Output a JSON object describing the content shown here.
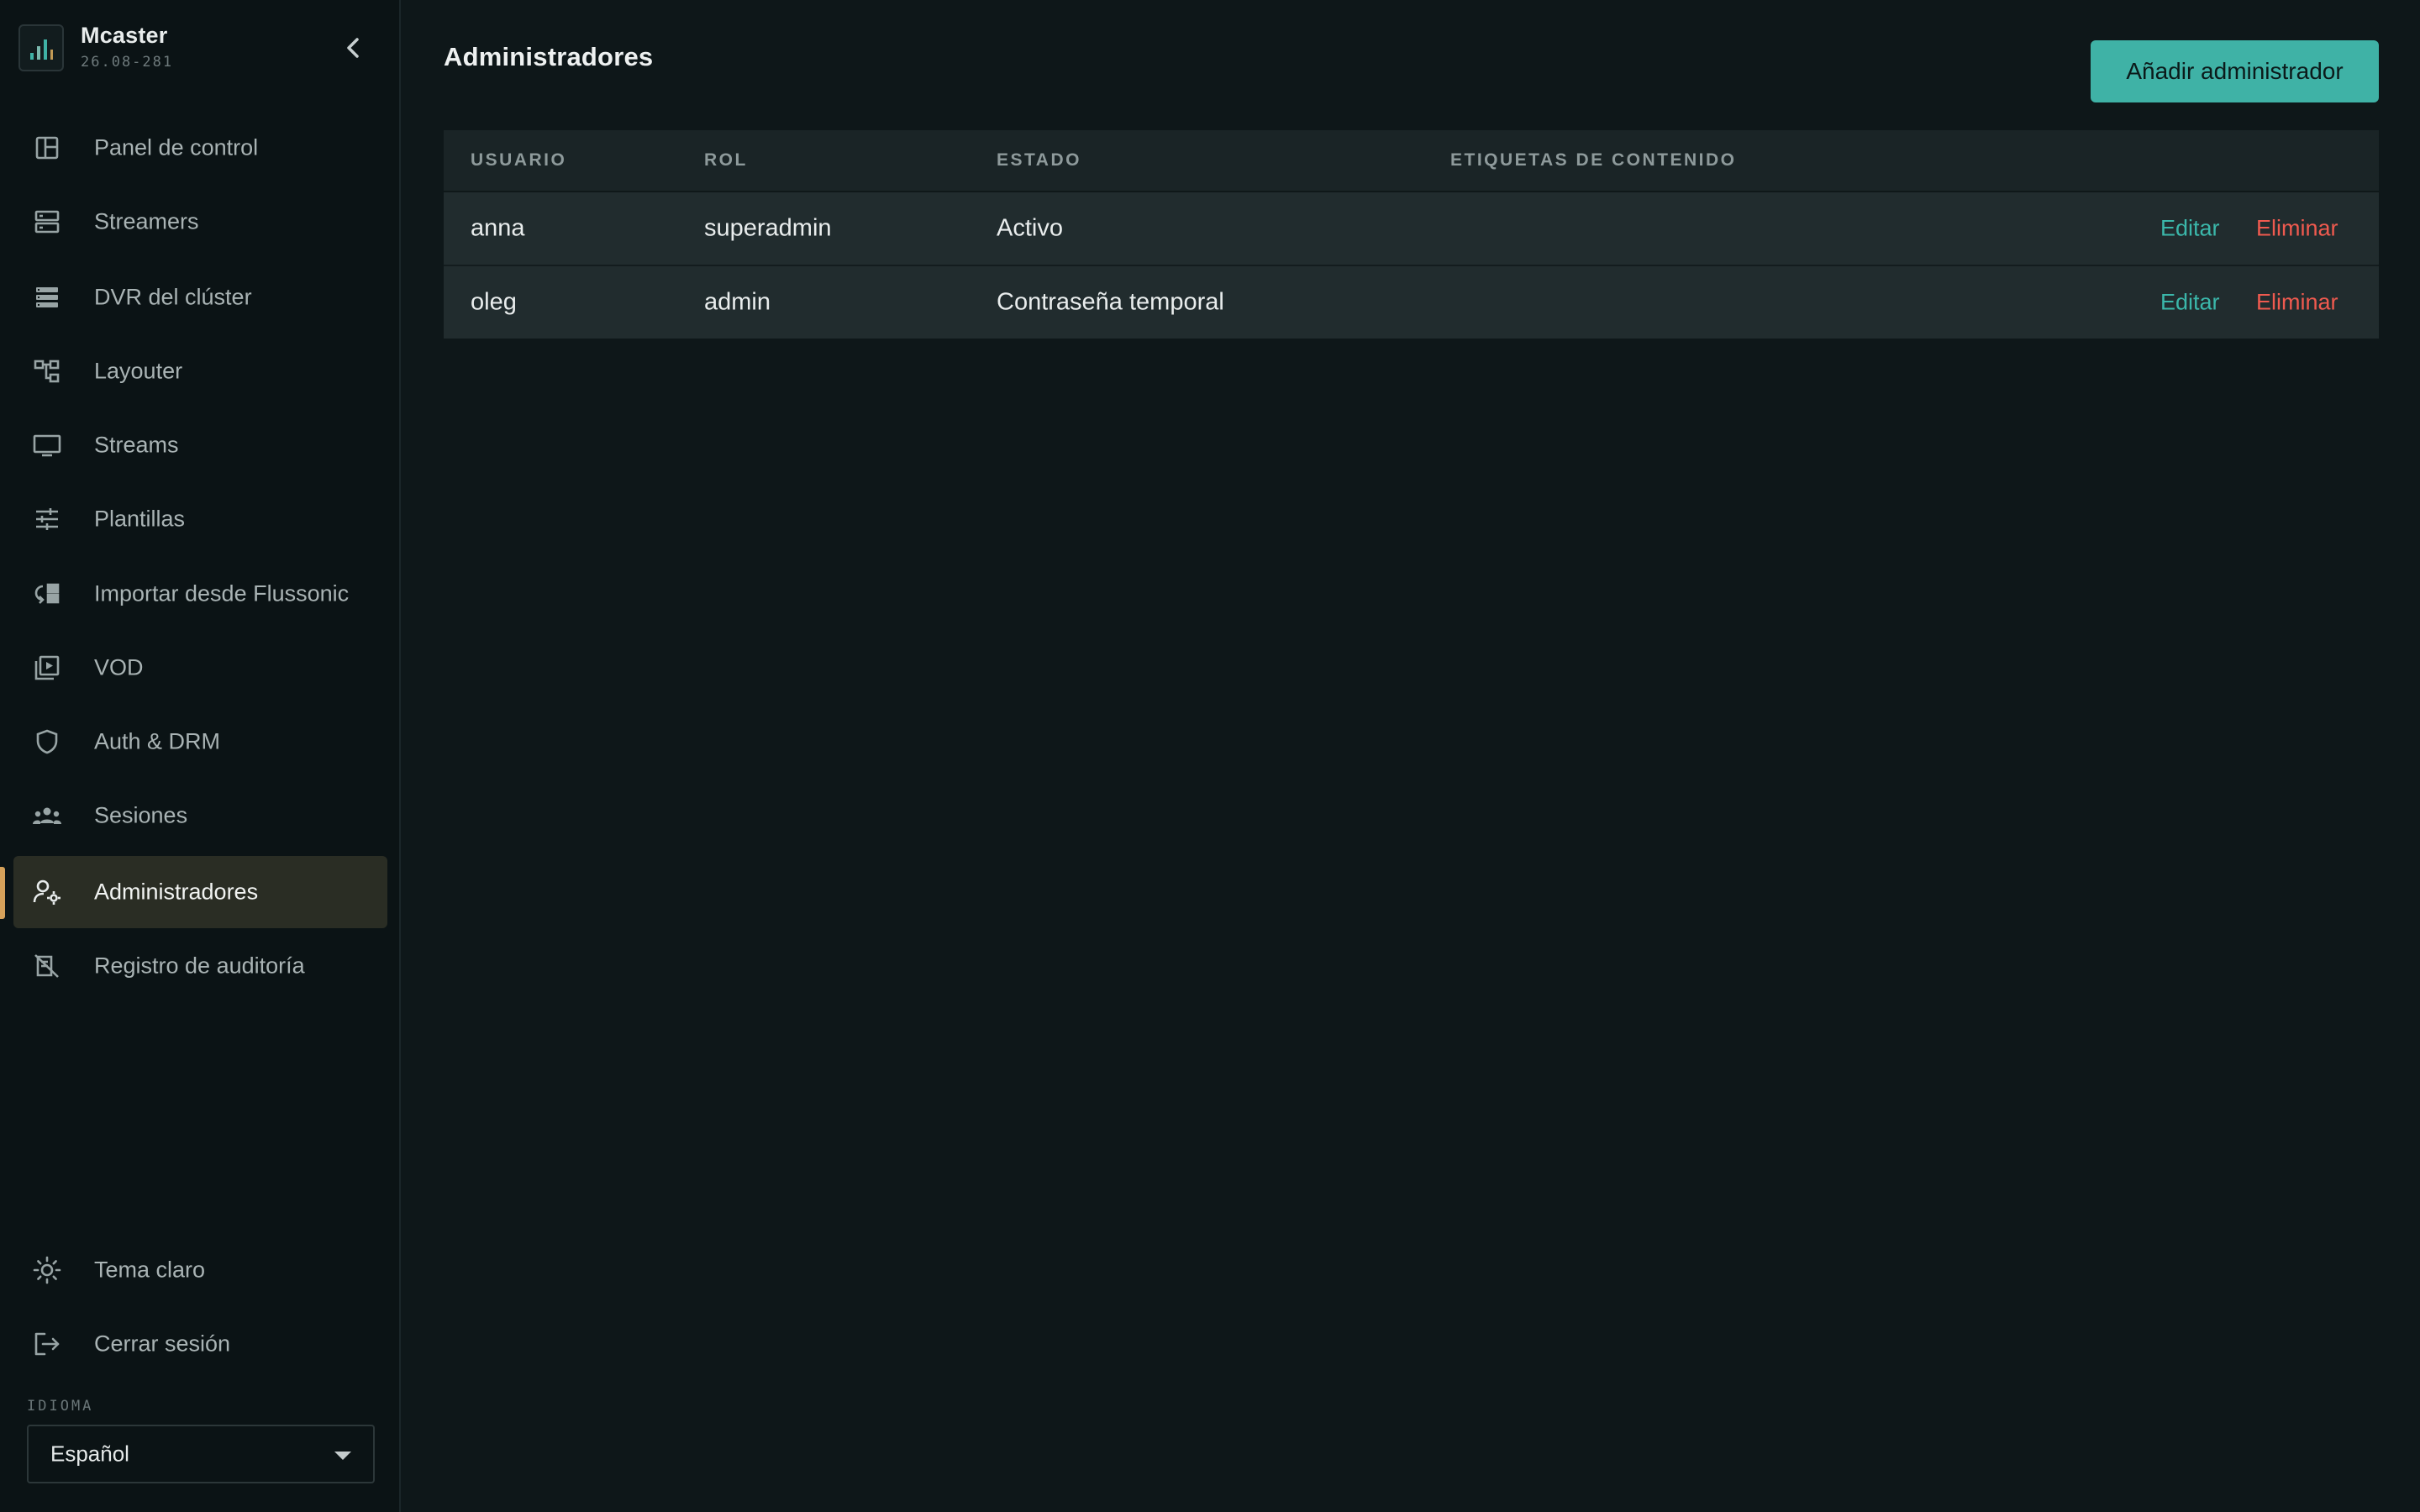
{
  "brand": {
    "name": "Mcaster",
    "version": "26.08-281"
  },
  "sidebar": {
    "items": [
      {
        "label": "Panel de control",
        "icon": "dashboard-icon"
      },
      {
        "label": "Streamers",
        "icon": "servers-icon"
      },
      {
        "label": "DVR del clúster",
        "icon": "storage-icon"
      },
      {
        "label": "Layouter",
        "icon": "layout-tree-icon"
      },
      {
        "label": "Streams",
        "icon": "monitor-icon"
      },
      {
        "label": "Plantillas",
        "icon": "sliders-icon"
      },
      {
        "label": "Importar desde Flussonic",
        "icon": "import-icon"
      },
      {
        "label": "VOD",
        "icon": "video-library-icon"
      },
      {
        "label": "Auth & DRM",
        "icon": "shield-icon"
      },
      {
        "label": "Sesiones",
        "icon": "users-group-icon"
      },
      {
        "label": "Administradores",
        "icon": "user-gear-icon",
        "active": true
      },
      {
        "label": "Registro de auditoría",
        "icon": "audit-icon"
      }
    ],
    "bottom": [
      {
        "label": "Tema claro",
        "icon": "sun-icon"
      },
      {
        "label": "Cerrar sesión",
        "icon": "logout-icon"
      }
    ],
    "language": {
      "label": "IDIOMA",
      "value": "Español"
    }
  },
  "main": {
    "title": "Administradores",
    "add_button": "Añadir administrador",
    "table": {
      "headers": [
        "USUARIO",
        "ROL",
        "ESTADO",
        "ETIQUETAS DE CONTENIDO"
      ],
      "rows": [
        {
          "user": "anna",
          "role": "superadmin",
          "state": "Activo",
          "tags": "",
          "edit": "Editar",
          "delete": "Eliminar"
        },
        {
          "user": "oleg",
          "role": "admin",
          "state": "Contraseña temporal",
          "tags": "",
          "edit": "Editar",
          "delete": "Eliminar"
        }
      ]
    }
  },
  "colors": {
    "accent": "#3fb2a6",
    "danger": "#ef5a4f",
    "active_marker": "#d6a15a",
    "background": "#0e1719"
  }
}
